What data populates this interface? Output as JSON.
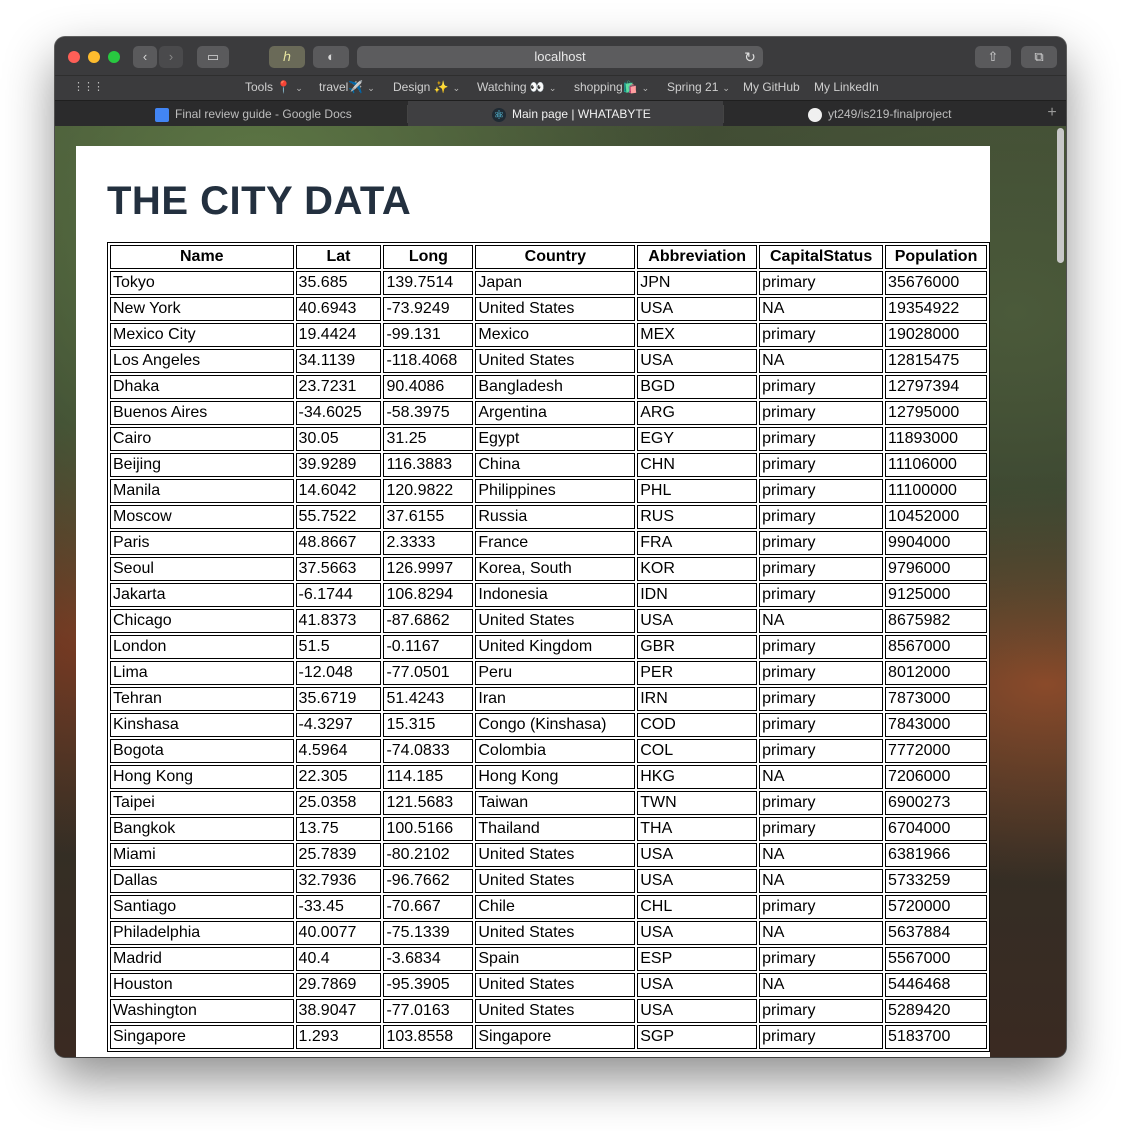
{
  "browser": {
    "url": "localhost",
    "bookmarks": [
      "Tools 📍",
      "travel✈️",
      "Design ✨",
      "Watching 👀",
      "shopping🛍️",
      "Spring 21",
      "My GitHub",
      "My LinkedIn"
    ],
    "tabs": [
      {
        "title": "Final review guide - Google Docs",
        "icon": "google-docs-icon"
      },
      {
        "title": "Main page | WHATABYTE",
        "icon": "react-icon"
      },
      {
        "title": "yt249/is219-finalproject",
        "icon": "github-icon"
      }
    ]
  },
  "page": {
    "title": "THE CITY DATA",
    "columns": [
      "Name",
      "Lat",
      "Long",
      "Country",
      "Abbreviation",
      "CapitalStatus",
      "Population"
    ],
    "rows": [
      [
        "Tokyo",
        "35.685",
        "139.7514",
        "Japan",
        "JPN",
        "primary",
        "35676000"
      ],
      [
        "New York",
        "40.6943",
        "-73.9249",
        "United States",
        "USA",
        "NA",
        "19354922"
      ],
      [
        "Mexico City",
        "19.4424",
        "-99.131",
        "Mexico",
        "MEX",
        "primary",
        "19028000"
      ],
      [
        "Los Angeles",
        "34.1139",
        "-118.4068",
        "United States",
        "USA",
        "NA",
        "12815475"
      ],
      [
        "Dhaka",
        "23.7231",
        "90.4086",
        "Bangladesh",
        "BGD",
        "primary",
        "12797394"
      ],
      [
        "Buenos Aires",
        "-34.6025",
        "-58.3975",
        "Argentina",
        "ARG",
        "primary",
        "12795000"
      ],
      [
        "Cairo",
        "30.05",
        "31.25",
        "Egypt",
        "EGY",
        "primary",
        "11893000"
      ],
      [
        "Beijing",
        "39.9289",
        "116.3883",
        "China",
        "CHN",
        "primary",
        "11106000"
      ],
      [
        "Manila",
        "14.6042",
        "120.9822",
        "Philippines",
        "PHL",
        "primary",
        "11100000"
      ],
      [
        "Moscow",
        "55.7522",
        "37.6155",
        "Russia",
        "RUS",
        "primary",
        "10452000"
      ],
      [
        "Paris",
        "48.8667",
        "2.3333",
        "France",
        "FRA",
        "primary",
        "9904000"
      ],
      [
        "Seoul",
        "37.5663",
        "126.9997",
        "Korea, South",
        "KOR",
        "primary",
        "9796000"
      ],
      [
        "Jakarta",
        "-6.1744",
        "106.8294",
        "Indonesia",
        "IDN",
        "primary",
        "9125000"
      ],
      [
        "Chicago",
        "41.8373",
        "-87.6862",
        "United States",
        "USA",
        "NA",
        "8675982"
      ],
      [
        "London",
        "51.5",
        "-0.1167",
        "United Kingdom",
        "GBR",
        "primary",
        "8567000"
      ],
      [
        "Lima",
        "-12.048",
        "-77.0501",
        "Peru",
        "PER",
        "primary",
        "8012000"
      ],
      [
        "Tehran",
        "35.6719",
        "51.4243",
        "Iran",
        "IRN",
        "primary",
        "7873000"
      ],
      [
        "Kinshasa",
        "-4.3297",
        "15.315",
        "Congo (Kinshasa)",
        "COD",
        "primary",
        "7843000"
      ],
      [
        "Bogota",
        "4.5964",
        "-74.0833",
        "Colombia",
        "COL",
        "primary",
        "7772000"
      ],
      [
        "Hong Kong",
        "22.305",
        "114.185",
        "Hong Kong",
        "HKG",
        "NA",
        "7206000"
      ],
      [
        "Taipei",
        "25.0358",
        "121.5683",
        "Taiwan",
        "TWN",
        "primary",
        "6900273"
      ],
      [
        "Bangkok",
        "13.75",
        "100.5166",
        "Thailand",
        "THA",
        "primary",
        "6704000"
      ],
      [
        "Miami",
        "25.7839",
        "-80.2102",
        "United States",
        "USA",
        "NA",
        "6381966"
      ],
      [
        "Dallas",
        "32.7936",
        "-96.7662",
        "United States",
        "USA",
        "NA",
        "5733259"
      ],
      [
        "Santiago",
        "-33.45",
        "-70.667",
        "Chile",
        "CHL",
        "primary",
        "5720000"
      ],
      [
        "Philadelphia",
        "40.0077",
        "-75.1339",
        "United States",
        "USA",
        "NA",
        "5637884"
      ],
      [
        "Madrid",
        "40.4",
        "-3.6834",
        "Spain",
        "ESP",
        "primary",
        "5567000"
      ],
      [
        "Houston",
        "29.7869",
        "-95.3905",
        "United States",
        "USA",
        "NA",
        "5446468"
      ],
      [
        "Washington",
        "38.9047",
        "-77.0163",
        "United States",
        "USA",
        "primary",
        "5289420"
      ],
      [
        "Singapore",
        "1.293",
        "103.8558",
        "Singapore",
        "SGP",
        "primary",
        "5183700"
      ]
    ]
  }
}
